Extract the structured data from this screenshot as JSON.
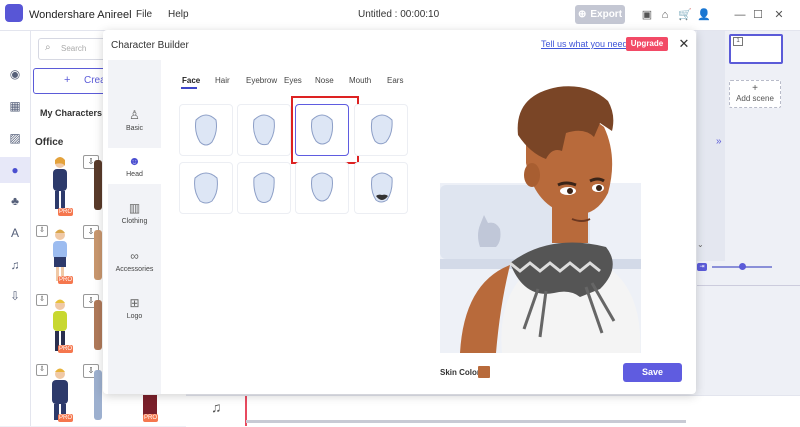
{
  "titlebar": {
    "app_name": "Wondershare Anireel",
    "menu": [
      "File",
      "Help"
    ],
    "doc_title": "Untitled : 00:00:10",
    "export_label": "Export"
  },
  "left_panel": {
    "search_placeholder": "Search",
    "create_label": "Creat",
    "my_characters": "My Characters",
    "category": "Office",
    "pro_badge": "PRO"
  },
  "right_panel": {
    "add_scene": "Add scene"
  },
  "modal": {
    "title": "Character Builder",
    "feedback_link": "Tell us what you need",
    "upgrade_label": "Upgrade",
    "categories": [
      {
        "label": "Basic",
        "icon": "person-icon"
      },
      {
        "label": "Head",
        "icon": "head-icon"
      },
      {
        "label": "Clothing",
        "icon": "shirt-icon"
      },
      {
        "label": "Accessories",
        "icon": "glasses-icon"
      },
      {
        "label": "Logo",
        "icon": "logo-icon"
      }
    ],
    "active_category": "Head",
    "tabs": [
      "Face",
      "Hair",
      "Eyebrow",
      "Eyes",
      "Nose",
      "Mouth",
      "Ears"
    ],
    "active_tab": "Face",
    "skin_color_label": "Skin Color",
    "skin_color": "#b86a3b",
    "save_label": "Save"
  },
  "colors": {
    "accent": "#5f5ce0",
    "upgrade": "#f24a66",
    "selection": "#dd2222"
  }
}
